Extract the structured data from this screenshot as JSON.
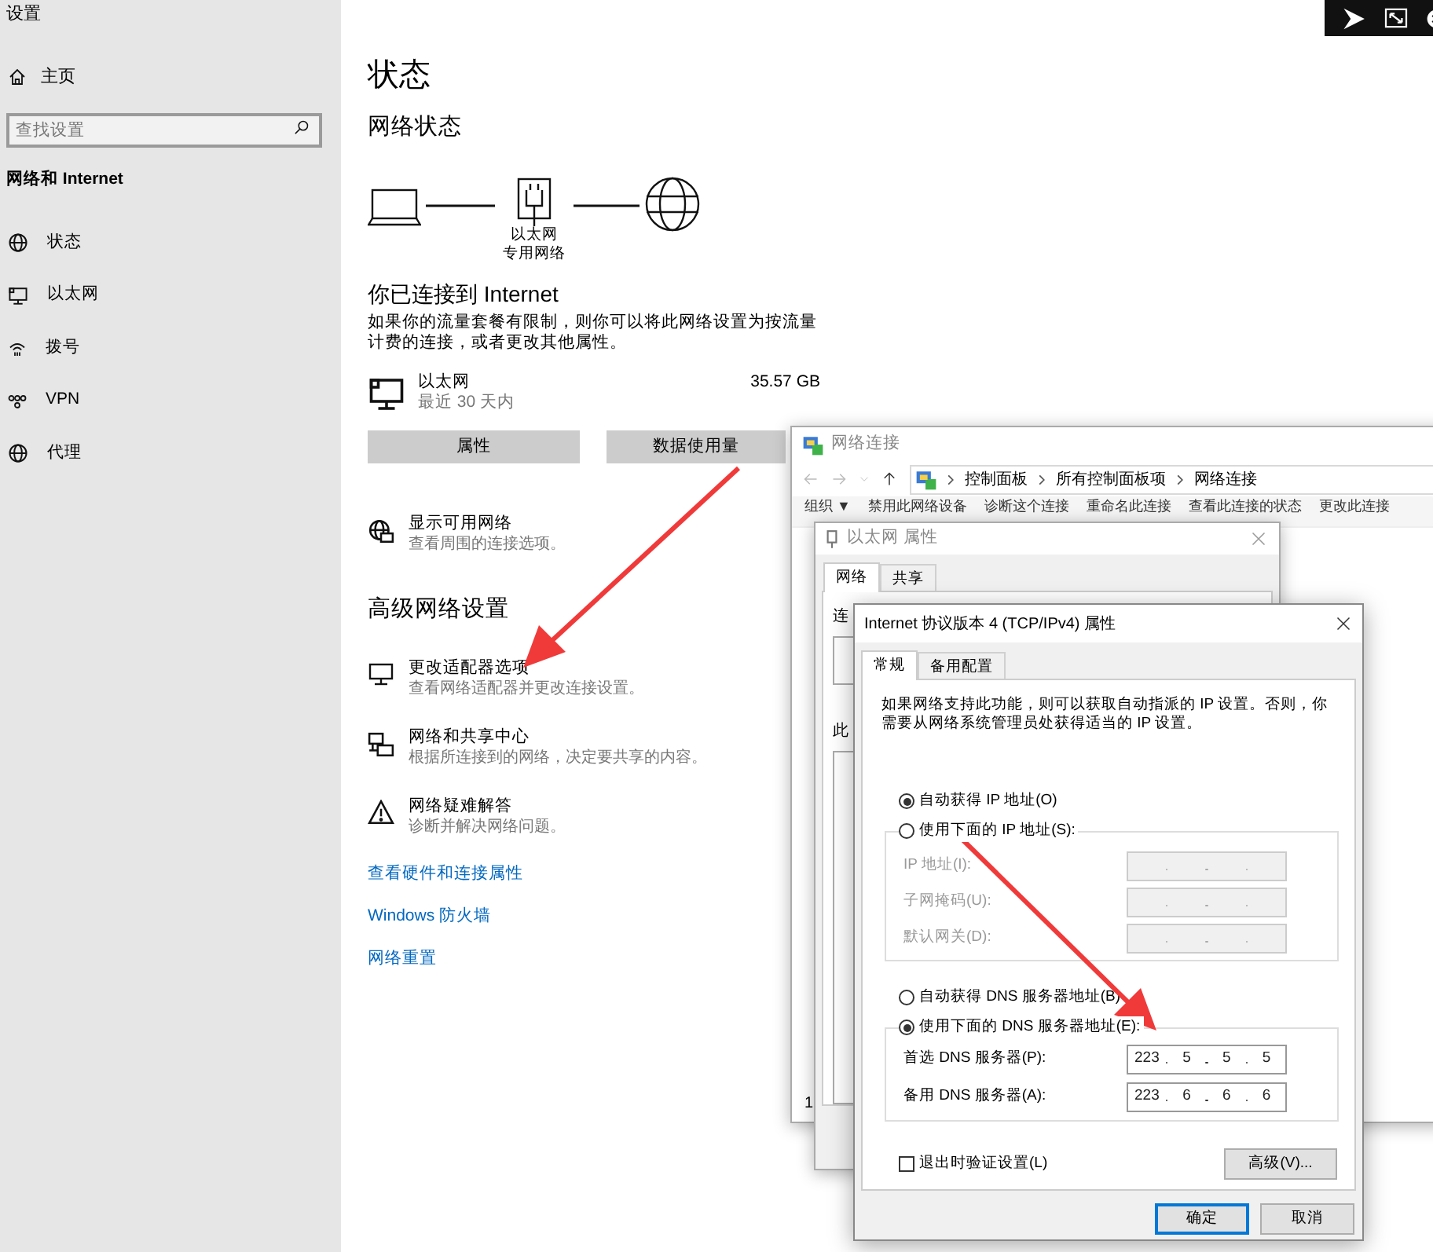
{
  "settings": {
    "title": "设置",
    "home": "主页",
    "search": {
      "placeholder": "查找设置"
    },
    "section": "网络和 Internet",
    "nav": [
      {
        "kind": "status",
        "label": "状态"
      },
      {
        "kind": "ethernet",
        "label": "以太网"
      },
      {
        "kind": "dialup",
        "label": "拨号"
      },
      {
        "kind": "vpn",
        "label": "VPN"
      },
      {
        "kind": "proxy",
        "label": "代理"
      }
    ]
  },
  "status": {
    "heading": "状态",
    "subheading": "网络状态",
    "diagram": {
      "label": "以太网",
      "sublabel": "专用网络"
    },
    "connected_title": "你已连接到 Internet",
    "connected_text": "如果你的流量套餐有限制，则你可以将此网络设置为按流量计费的连接，或者更改其他属性。",
    "adapter": {
      "name": "以太网",
      "period": "最近 30 天内",
      "usage": "35.57 GB"
    },
    "buttons": [
      "属性",
      "数据使用量"
    ],
    "show_networks": {
      "title": "显示可用网络",
      "subtitle": "查看周围的连接选项。"
    },
    "advanced_heading": "高级网络设置",
    "advanced": [
      {
        "kind": "adapter",
        "title": "更改适配器选项",
        "subtitle": "查看网络适配器并更改连接设置。"
      },
      {
        "kind": "sharing",
        "title": "网络和共享中心",
        "subtitle": "根据所连接到的网络，决定要共享的内容。"
      },
      {
        "kind": "troubleshoot",
        "title": "网络疑难解答",
        "subtitle": "诊断并解决网络问题。"
      }
    ],
    "links": [
      "查看硬件和连接属性",
      "Windows 防火墙",
      "网络重置"
    ]
  },
  "connections_window": {
    "title": "网络连接",
    "breadcrumb": [
      "控制面板",
      "所有控制面板项",
      "网络连接"
    ],
    "toolbar": [
      "组织 ▼",
      "禁用此网络设备",
      "诊断这个连接",
      "重命名此连接",
      "查看此连接的状态",
      "更改此连接"
    ],
    "status": "1"
  },
  "ethernet_properties": {
    "title": "以太网 属性",
    "tabs": [
      {
        "label": "网络",
        "selected": true
      },
      {
        "label": "共享",
        "selected": false
      }
    ],
    "label_1": "连",
    "label_2": "此"
  },
  "ipv4_properties": {
    "title": "Internet 协议版本 4 (TCP/IPv4) 属性",
    "tabs": [
      {
        "label": "常规",
        "selected": true
      },
      {
        "label": "备用配置",
        "selected": false
      }
    ],
    "description": "如果网络支持此功能，则可以获取自动指派的 IP 设置。否则，你需要从网络系统管理员处获得适当的 IP 设置。",
    "ip_mode": [
      {
        "label": "自动获得 IP 地址(O)",
        "selected": true
      },
      {
        "label": "使用下面的 IP 地址(S):",
        "selected": false
      }
    ],
    "ip_fields": {
      "disabled": true,
      "fields": [
        {
          "label": "IP 地址(I):"
        },
        {
          "label": "子网掩码(U):"
        },
        {
          "label": "默认网关(D):"
        }
      ]
    },
    "dns_mode": [
      {
        "label": "自动获得 DNS 服务器地址(B)",
        "selected": false
      },
      {
        "label": "使用下面的 DNS 服务器地址(E):",
        "selected": true
      }
    ],
    "dns_fields": [
      {
        "label": "首选 DNS 服务器(P):",
        "octets": [
          "223",
          "5",
          "5",
          "5"
        ]
      },
      {
        "label": "备用 DNS 服务器(A):",
        "octets": [
          "223",
          "6",
          "6",
          "6"
        ]
      }
    ],
    "validate": {
      "label": "退出时验证设置(L)",
      "checked": false
    },
    "advanced_button": "高级(V)...",
    "buttons": [
      "确定",
      "取消"
    ]
  }
}
